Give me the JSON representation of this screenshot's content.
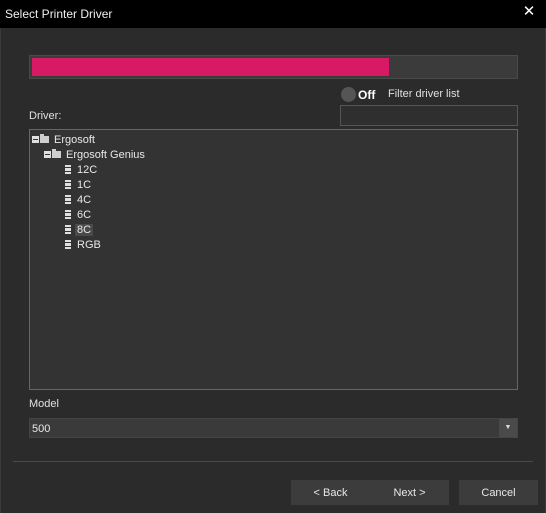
{
  "window": {
    "title": "Select Printer Driver",
    "close_glyph": "✕"
  },
  "progress": {
    "value_percent": 74,
    "color": "#d81a64"
  },
  "filter": {
    "toggle_label": "Off",
    "label": "Filter driver list",
    "value": ""
  },
  "driver_label": "Driver:",
  "tree": {
    "root": {
      "label": "Ergosoft",
      "expanded": true
    },
    "group": {
      "label": "Ergosoft Genius",
      "expanded": true
    },
    "items": [
      {
        "label": "12C",
        "selected": false
      },
      {
        "label": "1C",
        "selected": false
      },
      {
        "label": "4C",
        "selected": false
      },
      {
        "label": "6C",
        "selected": false
      },
      {
        "label": "8C",
        "selected": true
      },
      {
        "label": "RGB",
        "selected": false
      }
    ]
  },
  "model": {
    "label": "Model",
    "value": "500"
  },
  "buttons": {
    "back": "< Back",
    "next": "Next >",
    "cancel": "Cancel"
  }
}
